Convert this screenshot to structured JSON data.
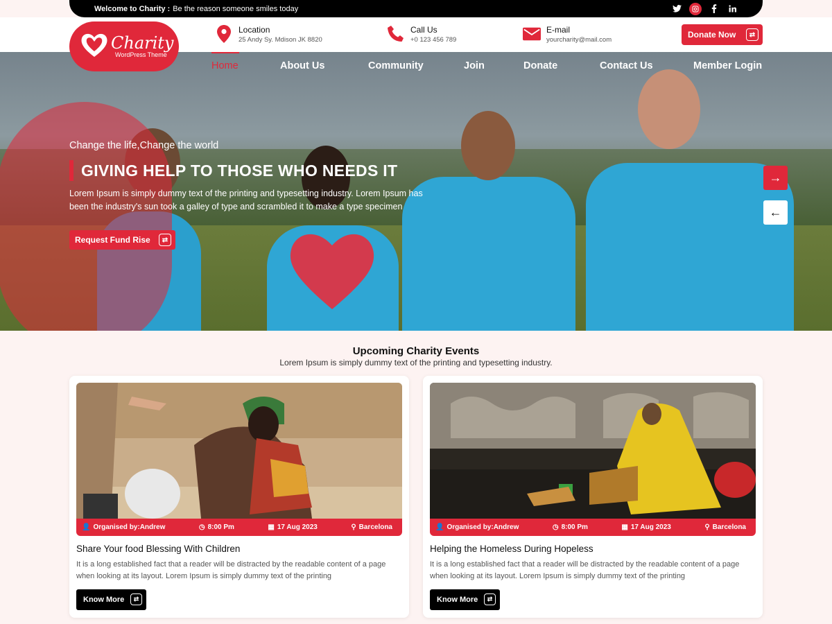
{
  "topbar": {
    "welcome_bold": "Welcome to Charity :",
    "welcome_text": "Be the reason someone smiles today",
    "social": [
      "twitter-icon",
      "instagram-icon",
      "facebook-icon",
      "linkedin-icon"
    ]
  },
  "logo": {
    "name": "Charity",
    "tagline": "WordPress Theme"
  },
  "contacts": [
    {
      "icon": "location-pin-icon",
      "title": "Location",
      "value": "25 Andy Sy. Mdison JK 8820"
    },
    {
      "icon": "phone-icon",
      "title": "Call Us",
      "value": "+0 123 456 789"
    },
    {
      "icon": "mail-icon",
      "title": "E-mail",
      "value": "yourcharity@mail.com"
    }
  ],
  "donate_button": "Donate Now",
  "nav": [
    "Home",
    "About Us",
    "Community",
    "Join",
    "Donate",
    "Contact Us",
    "Member Login"
  ],
  "hero": {
    "subtitle": "Change the life,Change the world",
    "title": "GIVING HELP TO THOSE WHO NEEDS IT",
    "text": "Lorem Ipsum is simply dummy text of the printing and typesetting industry. Lorem Ipsum has been the industry's sun took a galley of type and scrambled it to make a type specimen",
    "button": "Request Fund Rise"
  },
  "events": {
    "title": "Upcoming Charity Events",
    "subtitle": "Lorem Ipsum is simply dummy text of the printing and typesetting industry.",
    "cards": [
      {
        "organiser": "Organised by:Andrew",
        "time": "8:00 Pm",
        "date": "17 Aug 2023",
        "place": "Barcelona",
        "title": "Share Your food Blessing With Children",
        "text": "It is a long established fact that a reader will be distracted by the readable content of a page when looking at its layout. Lorem Ipsum is simply dummy text of the printing",
        "button": "Know More"
      },
      {
        "organiser": "Organised by:Andrew",
        "time": "8:00 Pm",
        "date": "17 Aug 2023",
        "place": "Barcelona",
        "title": "Helping the Homeless During Hopeless",
        "text": "It is a long established fact that a reader will be distracted by the readable content of a page when looking at its layout. Lorem Ipsum is simply dummy text of the printing",
        "button": "Know More"
      }
    ]
  },
  "colors": {
    "accent": "#e0283a",
    "dark": "#000000",
    "section_bg": "#fdf3f2"
  }
}
